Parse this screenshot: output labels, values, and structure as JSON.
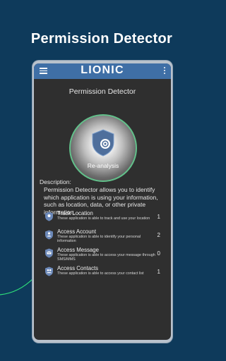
{
  "headline": "Permission Detector",
  "app": {
    "brand": "LIONIC",
    "screen_title": "Permission Detector",
    "scan_button_label": "Re-analysis",
    "description_label": "Description:",
    "description_text": "Permission Detector allows you to identify which application is using your information, such as location, data, or other private information.",
    "permissions": [
      {
        "name": "Track Location",
        "desc": "These application is able to track and use your location",
        "count": "1",
        "icon": "location-shield-icon"
      },
      {
        "name": "Access Account",
        "desc": "These application is able to identify your personal information",
        "count": "2",
        "icon": "account-shield-icon"
      },
      {
        "name": "Access Message",
        "desc": "These application is able to access your message through SMS/MMS",
        "count": "0",
        "icon": "message-shield-icon"
      },
      {
        "name": "Access Contacts",
        "desc": "These application is able to access your contact list",
        "count": "1",
        "icon": "contacts-shield-icon"
      }
    ]
  },
  "colors": {
    "background": "#0e3a5b",
    "appbar": "#3f6fa6",
    "screen": "#2f2f2f",
    "ring": "#62c08a"
  }
}
